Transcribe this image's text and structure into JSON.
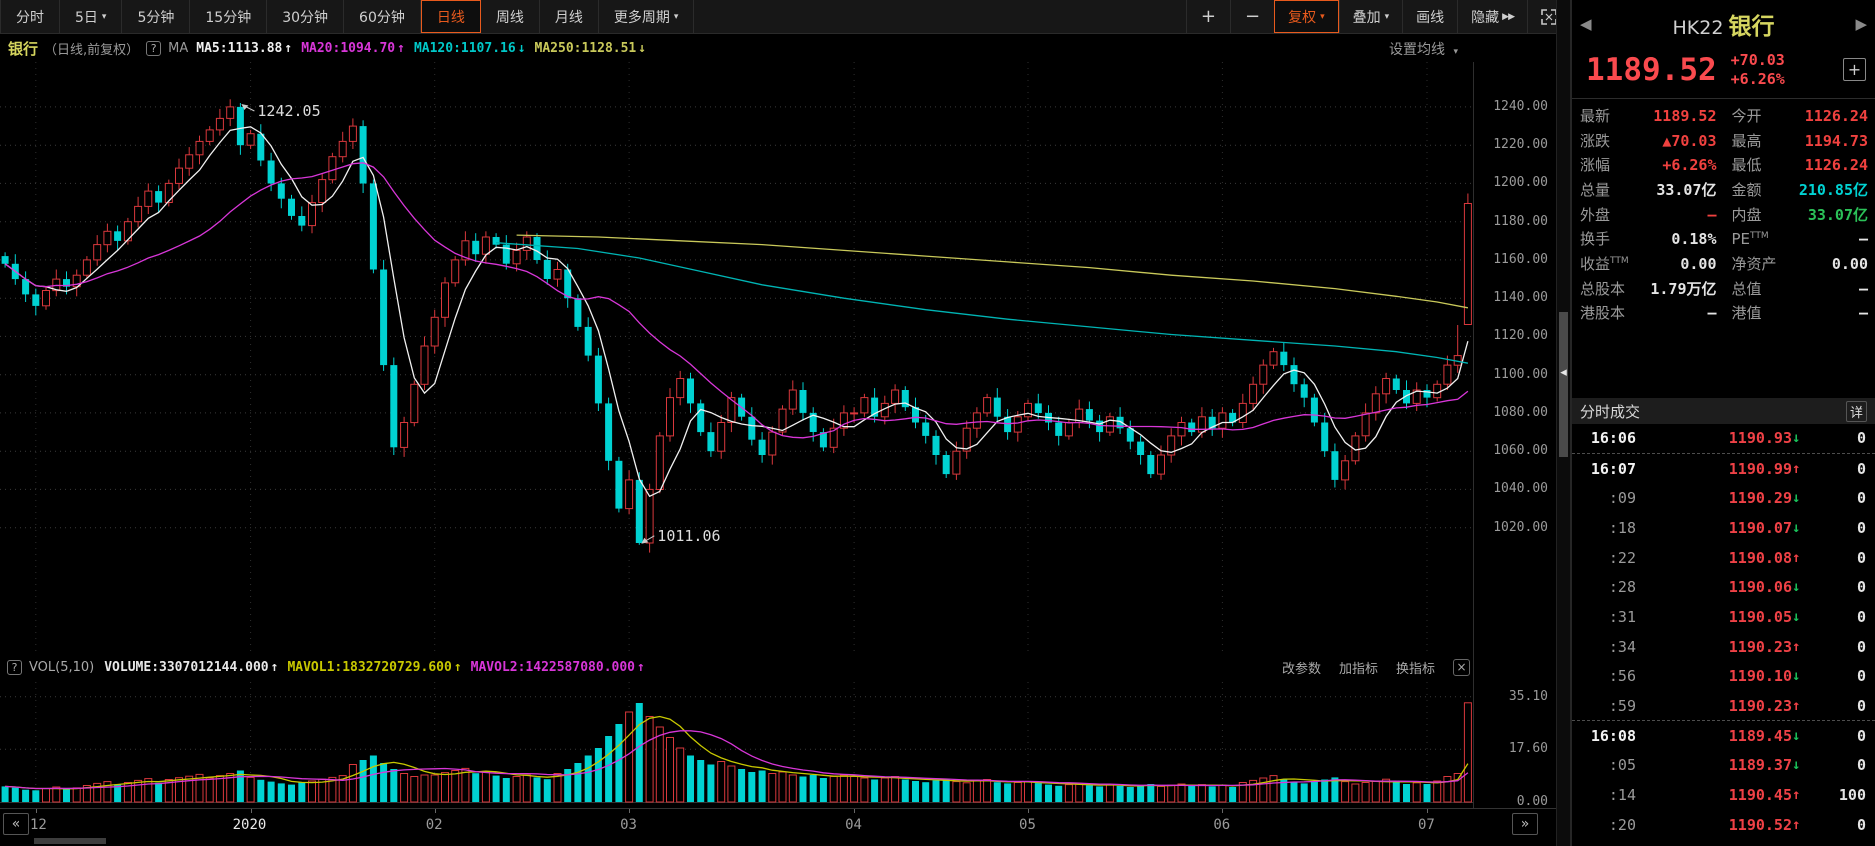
{
  "icons": {
    "prev_arrow": "◀",
    "next_arrow": "▶",
    "caret_down": "▾",
    "up_arrow": "↑",
    "down_arrow": "↓",
    "collapse_handle": "◂",
    "fast_forward": "▶▶",
    "help": "?",
    "close": "×",
    "add": "+",
    "scroll_left": "«",
    "scroll_right": "»",
    "fullscreen": "expand-corners"
  },
  "colors": {
    "up": "#d9383c",
    "down": "#00d2d2",
    "ma5": "#f0f0f0",
    "ma20": "#d836d8",
    "ma120": "#00b4b4",
    "ma250": "#c9c95a",
    "mavol1": "#c8c800",
    "mavol2": "#d836d8",
    "grid": "#3a3a3a",
    "accent_orange": "#e85a1d",
    "price_red": "#fa4a4e"
  },
  "toolbar": {
    "tabs": [
      {
        "label": "分时"
      },
      {
        "label": "5日",
        "caret": true
      },
      {
        "label": "5分钟"
      },
      {
        "label": "15分钟"
      },
      {
        "label": "30分钟"
      },
      {
        "label": "60分钟"
      },
      {
        "label": "日线",
        "active": true
      },
      {
        "label": "周线"
      },
      {
        "label": "月线"
      },
      {
        "label": "更多周期",
        "caret": true
      }
    ],
    "zoom_in": "+",
    "zoom_out": "−",
    "buttons": [
      {
        "label": "复权",
        "caret": true,
        "accent": true
      },
      {
        "label": "叠加",
        "caret": true
      },
      {
        "label": "画线"
      },
      {
        "label": "隐藏",
        "ffwd": true
      },
      {
        "label": "",
        "icon": "fullscreen"
      }
    ]
  },
  "chart_header": {
    "symbol_name": "银行",
    "mode": "（日线,前复权）",
    "help_label": "?",
    "indicator_label": "MA",
    "ma_items": [
      {
        "text": "MA5:1113.88",
        "dir": "up",
        "color": "#f0f0f0"
      },
      {
        "text": "MA20:1094.70",
        "dir": "up",
        "color": "#d836d8"
      },
      {
        "text": "MA120:1107.16",
        "dir": "down",
        "color": "#00c8c8"
      },
      {
        "text": "MA250:1128.51",
        "dir": "down",
        "color": "#c9c95a"
      }
    ],
    "settings_label": "设置均线"
  },
  "volume_header": {
    "help_label": "?",
    "name": "VOL(5,10)",
    "items": [
      {
        "text": "VOLUME:3307012144.000",
        "dir": "up",
        "color": "#e8e8e8"
      },
      {
        "text": "MAVOL1:1832720729.600",
        "dir": "up",
        "color": "#c8c800"
      },
      {
        "text": "MAVOL2:1422587080.000",
        "dir": "up",
        "color": "#d836d8"
      }
    ],
    "tools": [
      "改参数",
      "加指标",
      "换指标"
    ],
    "close_label": "×"
  },
  "axis": {
    "prev_label": "«",
    "next_label": "»",
    "ticks": [
      {
        "label": "12",
        "index": 3
      },
      {
        "label": "2020",
        "index": 24,
        "highlight": true
      },
      {
        "label": "02",
        "index": 42
      },
      {
        "label": "03",
        "index": 61
      },
      {
        "label": "04",
        "index": 83
      },
      {
        "label": "05",
        "index": 100
      },
      {
        "label": "06",
        "index": 119
      },
      {
        "label": "07",
        "index": 139
      }
    ]
  },
  "chart_data": {
    "type": "candlestick+volume",
    "title": "银行 HK22 日线 前复权",
    "price_ticks": [
      1240,
      1220,
      1200,
      1180,
      1160,
      1140,
      1120,
      1100,
      1080,
      1060,
      1040,
      1020
    ],
    "volume_ticks": [
      "35.10",
      "17.60",
      "0.00"
    ],
    "annotations": {
      "high": {
        "text": "1242.05",
        "index": 23
      },
      "low": {
        "text": "1011.06",
        "index": 62
      }
    },
    "closes": [
      1158,
      1150,
      1142,
      1136,
      1144,
      1150,
      1146,
      1152,
      1160,
      1168,
      1175,
      1170,
      1180,
      1188,
      1196,
      1190,
      1200,
      1208,
      1215,
      1222,
      1228,
      1234,
      1240,
      1220,
      1226,
      1212,
      1200,
      1192,
      1183,
      1178,
      1190,
      1202,
      1214,
      1222,
      1230,
      1200,
      1155,
      1105,
      1062,
      1075,
      1095,
      1115,
      1130,
      1148,
      1160,
      1170,
      1163,
      1172,
      1168,
      1158,
      1165,
      1172,
      1160,
      1150,
      1155,
      1140,
      1125,
      1110,
      1085,
      1055,
      1030,
      1045,
      1012,
      1040,
      1068,
      1088,
      1098,
      1085,
      1070,
      1060,
      1075,
      1088,
      1078,
      1066,
      1058,
      1070,
      1082,
      1092,
      1080,
      1070,
      1062,
      1072,
      1080,
      1080,
      1088,
      1078,
      1085,
      1092,
      1083,
      1075,
      1068,
      1058,
      1048,
      1060,
      1072,
      1080,
      1088,
      1078,
      1070,
      1078,
      1085,
      1080,
      1075,
      1068,
      1075,
      1082,
      1076,
      1070,
      1078,
      1072,
      1065,
      1058,
      1048,
      1058,
      1068,
      1075,
      1070,
      1078,
      1072,
      1080,
      1075,
      1085,
      1095,
      1105,
      1112,
      1105,
      1095,
      1088,
      1075,
      1060,
      1045,
      1055,
      1068,
      1080,
      1090,
      1098,
      1092,
      1085,
      1092,
      1088,
      1095,
      1105,
      1110,
      1189.52
    ],
    "volumes": [
      5.2,
      4.8,
      4.1,
      3.9,
      4.5,
      5.0,
      4.3,
      4.7,
      5.5,
      6.2,
      6.8,
      5.9,
      6.5,
      7.2,
      7.8,
      6.4,
      7.5,
      8.1,
      8.6,
      9.2,
      8.0,
      8.8,
      9.5,
      10.5,
      8.2,
      7.4,
      6.8,
      6.2,
      5.8,
      6.5,
      7.0,
      7.6,
      8.2,
      8.8,
      12.5,
      14.0,
      15.5,
      13.0,
      11.0,
      9.5,
      8.5,
      9.0,
      9.0,
      9.8,
      10.5,
      11.2,
      9.6,
      10.2,
      8.8,
      8.0,
      8.5,
      9.0,
      8.2,
      7.6,
      9.5,
      11.0,
      13.0,
      15.5,
      18.0,
      22.0,
      26.0,
      30.0,
      33.0,
      28.5,
      25.0,
      21.5,
      18.0,
      15.5,
      14.0,
      12.5,
      13.5,
      12.0,
      11.0,
      10.0,
      10.5,
      9.5,
      10.0,
      9.0,
      8.5,
      9.0,
      8.0,
      8.5,
      9.0,
      8.5,
      8.0,
      7.5,
      8.0,
      8.5,
      7.5,
      7.0,
      6.6,
      7.2,
      7.8,
      6.8,
      6.4,
      7.0,
      7.5,
      6.6,
      6.2,
      6.5,
      6.8,
      6.3,
      5.8,
      5.4,
      5.8,
      6.2,
      5.6,
      5.2,
      5.8,
      5.4,
      5.0,
      5.5,
      6.0,
      5.2,
      5.6,
      6.0,
      5.4,
      5.8,
      5.2,
      5.6,
      5.0,
      6.5,
      7.2,
      8.0,
      8.8,
      7.6,
      6.8,
      6.2,
      6.8,
      7.5,
      8.2,
      6.8,
      6.0,
      6.5,
      7.0,
      7.6,
      6.6,
      6.0,
      6.4,
      6.0,
      7.0,
      8.5,
      9.5,
      33.07
    ],
    "wick_overrides": {
      "23": {
        "high": 1242.05
      },
      "62": {
        "low": 1011.06
      },
      "142": {
        "high": 1126
      },
      "143": {
        "open": 1126.24,
        "high": 1194.73,
        "low": 1126.24
      }
    },
    "ma120_points": [
      [
        48,
        1169
      ],
      [
        56,
        1166
      ],
      [
        62,
        1161
      ],
      [
        68,
        1154
      ],
      [
        74,
        1147
      ],
      [
        82,
        1140
      ],
      [
        90,
        1134
      ],
      [
        98,
        1129
      ],
      [
        106,
        1125
      ],
      [
        114,
        1121
      ],
      [
        122,
        1118
      ],
      [
        130,
        1115
      ],
      [
        136,
        1112
      ],
      [
        140,
        1109
      ],
      [
        143,
        1106
      ]
    ],
    "ma250_points": [
      [
        50,
        1173
      ],
      [
        58,
        1172
      ],
      [
        66,
        1170
      ],
      [
        74,
        1168
      ],
      [
        82,
        1165
      ],
      [
        90,
        1162
      ],
      [
        98,
        1159
      ],
      [
        106,
        1156
      ],
      [
        114,
        1152
      ],
      [
        122,
        1149
      ],
      [
        130,
        1145
      ],
      [
        136,
        1141
      ],
      [
        140,
        1138
      ],
      [
        143,
        1135
      ]
    ]
  },
  "quote": {
    "code": "HK22",
    "name": "银行",
    "last_price": "1189.52",
    "change": "+70.03",
    "change_pct": "+6.26%",
    "add_label": "+",
    "stats": [
      [
        {
          "label": "最新",
          "value": "1189.52",
          "color": "red"
        },
        {
          "label": "今开",
          "value": "1126.24",
          "color": "red"
        }
      ],
      [
        {
          "label": "涨跌",
          "value": "▲70.03",
          "color": "red"
        },
        {
          "label": "最高",
          "value": "1194.73",
          "color": "red"
        }
      ],
      [
        {
          "label": "涨幅",
          "value": "+6.26%",
          "color": "red"
        },
        {
          "label": "最低",
          "value": "1126.24",
          "color": "red"
        }
      ],
      [
        {
          "label": "总量",
          "value": "33.07亿",
          "color": "white"
        },
        {
          "label": "金额",
          "value": "210.85亿",
          "color": "cyan"
        }
      ],
      [
        {
          "label": "外盘",
          "value": "—",
          "color": "red"
        },
        {
          "label": "内盘",
          "value": "33.07亿",
          "color": "green"
        }
      ],
      [
        {
          "label": "换手",
          "value": "0.18%",
          "color": "white"
        },
        {
          "label": "PE",
          "sup": "TTM",
          "value": "—",
          "color": "white"
        }
      ],
      [
        {
          "label": "收益",
          "sup": "TTM",
          "value": "0.00",
          "color": "white"
        },
        {
          "label": "净资产",
          "value": "0.00",
          "color": "white"
        }
      ],
      [
        {
          "label": "总股本",
          "value": "1.79万亿",
          "color": "white"
        },
        {
          "label": "总值",
          "value": "—",
          "color": "white"
        }
      ],
      [
        {
          "label": "港股本",
          "value": "—",
          "color": "white"
        },
        {
          "label": "港值",
          "value": "—",
          "color": "white"
        }
      ]
    ]
  },
  "time_sales": {
    "title": "分时成交",
    "detail_label": "详",
    "rows": [
      {
        "time": "16:06",
        "hour": true,
        "price": "1190.93",
        "dir": "down",
        "vol": "0",
        "divider_after": true
      },
      {
        "time": "16:07",
        "hour": true,
        "price": "1190.99",
        "dir": "up",
        "vol": "0"
      },
      {
        "time": ":09",
        "price": "1190.29",
        "dir": "down",
        "vol": "0"
      },
      {
        "time": ":18",
        "price": "1190.07",
        "dir": "down",
        "vol": "0"
      },
      {
        "time": ":22",
        "price": "1190.08",
        "dir": "up",
        "vol": "0"
      },
      {
        "time": ":28",
        "price": "1190.06",
        "dir": "down",
        "vol": "0"
      },
      {
        "time": ":31",
        "price": "1190.05",
        "dir": "down",
        "vol": "0"
      },
      {
        "time": ":34",
        "price": "1190.23",
        "dir": "up",
        "vol": "0"
      },
      {
        "time": ":56",
        "price": "1190.10",
        "dir": "down",
        "vol": "0"
      },
      {
        "time": ":59",
        "price": "1190.23",
        "dir": "up",
        "vol": "0",
        "divider_after": true
      },
      {
        "time": "16:08",
        "hour": true,
        "price": "1189.45",
        "dir": "down",
        "vol": "0"
      },
      {
        "time": ":05",
        "price": "1189.37",
        "dir": "down",
        "vol": "0"
      },
      {
        "time": ":14",
        "price": "1190.45",
        "dir": "up",
        "vol": "100"
      },
      {
        "time": ":20",
        "price": "1190.52",
        "dir": "up",
        "vol": "0"
      }
    ]
  }
}
